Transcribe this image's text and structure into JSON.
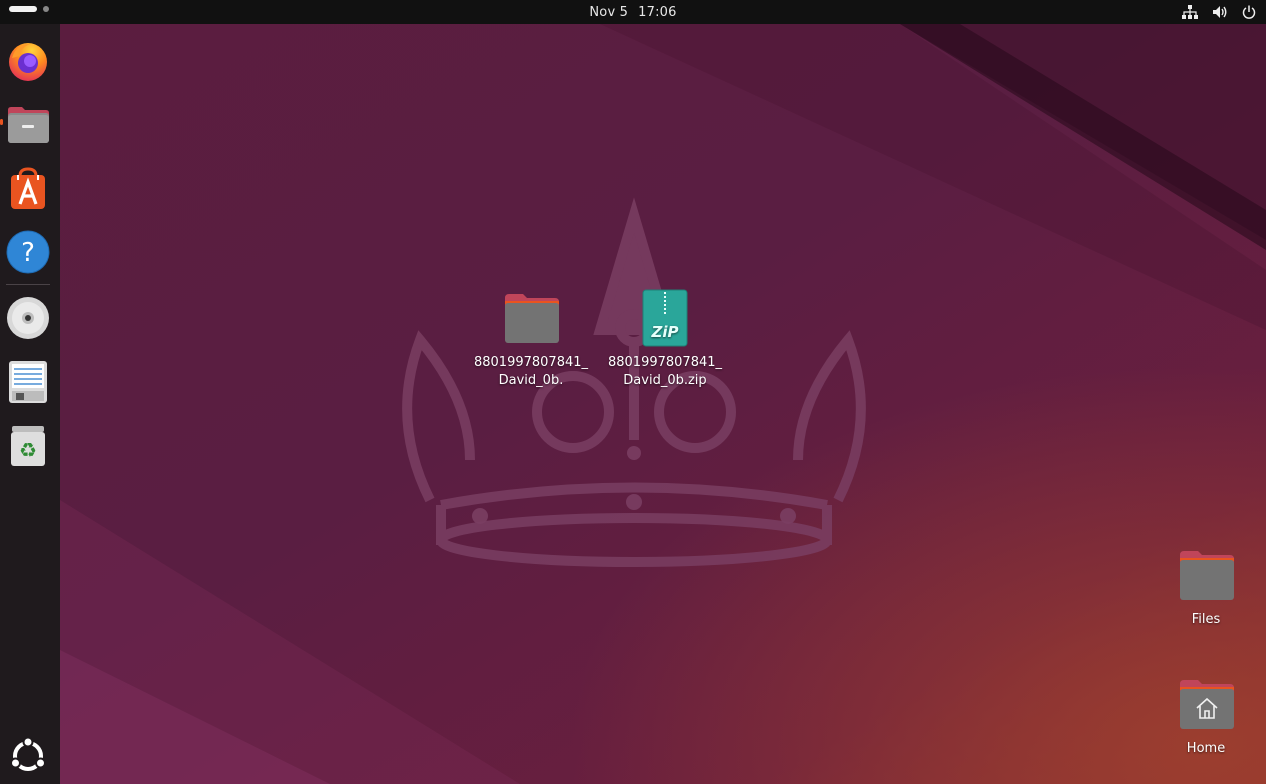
{
  "topbar": {
    "date": "Nov 5",
    "time": "17:06",
    "tray_icons": [
      "network-icon",
      "volume-icon",
      "power-icon"
    ]
  },
  "dock": {
    "items": [
      {
        "name": "firefox",
        "icon": "firefox-icon",
        "running": false
      },
      {
        "name": "files",
        "icon": "files-icon",
        "running": true
      },
      {
        "name": "app-center",
        "icon": "app-center-icon",
        "running": false
      },
      {
        "name": "help",
        "icon": "help-icon",
        "running": false
      },
      {
        "name": "disc",
        "icon": "disc-icon",
        "running": false
      },
      {
        "name": "text-editor",
        "icon": "text-editor-icon",
        "running": false
      },
      {
        "name": "trash",
        "icon": "trash-icon",
        "running": false
      }
    ],
    "show_apps_icon": "ubuntu-show-apps-icon"
  },
  "desktop": {
    "icons": [
      {
        "line1": "8801997807841_",
        "line2": "David_0b.",
        "icon": "folder-icon"
      },
      {
        "line1": "8801997807841_",
        "line2": "David_0b.zip",
        "icon": "zip-archive-icon"
      },
      {
        "label": "Files",
        "icon": "folder-icon"
      },
      {
        "label": "Home",
        "icon": "home-folder-icon"
      }
    ]
  },
  "colors": {
    "accent": "#e95420",
    "folder_tab": "#c0455a",
    "folder_body": "#737373",
    "zip": "#2aa69a"
  }
}
